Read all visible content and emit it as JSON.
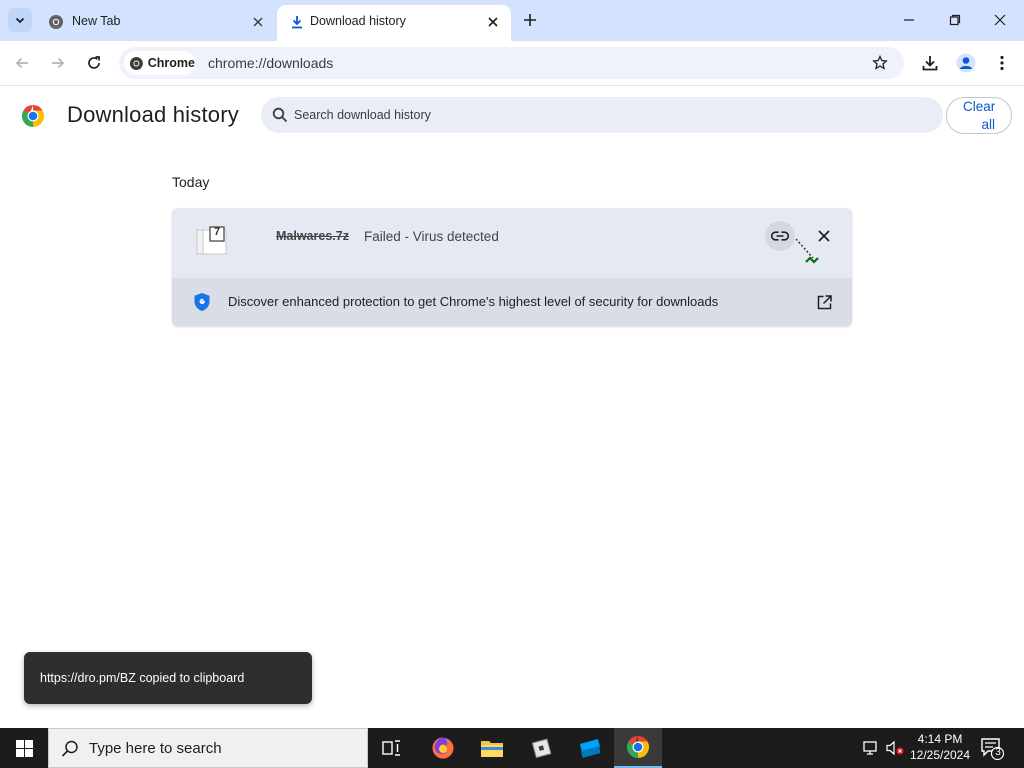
{
  "browser": {
    "tabs": [
      {
        "title": "New Tab",
        "active": false
      },
      {
        "title": "Download history",
        "active": true
      }
    ],
    "omnibox": {
      "chip_label": "Chrome",
      "url": "chrome://downloads"
    }
  },
  "page": {
    "title": "Download history",
    "search": {
      "placeholder": "Search download history"
    },
    "clear_all": {
      "line1": "Clear",
      "line2": "all"
    },
    "sections": [
      {
        "date": "Today",
        "items": [
          {
            "file_name": "Malwares.7z",
            "file_icon_label": "7",
            "status": "Failed - Virus detected",
            "promo": "Discover enhanced protection to get Chrome's highest level of security for downloads"
          }
        ]
      }
    ]
  },
  "toast": {
    "text": "https://dro.pm/BZ copied to clipboard"
  },
  "taskbar": {
    "search_placeholder": "Type here to search",
    "apps": [
      "task-view",
      "firefox",
      "file-explorer",
      "roblox",
      "roblox-studio",
      "chrome"
    ],
    "clock": {
      "time": "4:14 PM",
      "date": "12/25/2024"
    },
    "notification_count": "3"
  },
  "colors": {
    "tabstrip": "#d3e3fd",
    "accent": "#0b57d0",
    "card": "#e4e9f2",
    "taskbar": "#1c1c1c"
  }
}
